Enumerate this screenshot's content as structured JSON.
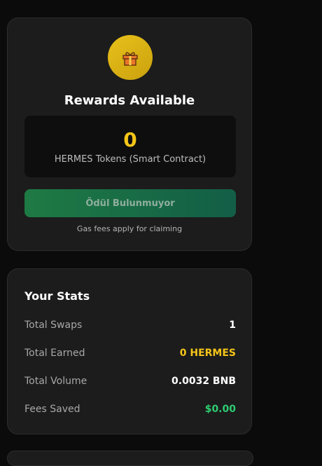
{
  "rewards": {
    "title": "Rewards Available",
    "amount": "0",
    "token_label": "HERMES Tokens (Smart Contract)",
    "claim_button": "Ödül Bulunmuyor",
    "gas_note": "Gas fees apply for claiming",
    "icon": "gift-icon"
  },
  "stats": {
    "title": "Your Stats",
    "rows": [
      {
        "label": "Total Swaps",
        "value": "1",
        "color": "#ffffff"
      },
      {
        "label": "Total Earned",
        "value": "0 HERMES",
        "color": "#f5c518"
      },
      {
        "label": "Total Volume",
        "value": "0.0032 BNB",
        "color": "#ffffff"
      },
      {
        "label": "Fees Saved",
        "value": "$0.00",
        "color": "#2ecc71"
      }
    ]
  }
}
